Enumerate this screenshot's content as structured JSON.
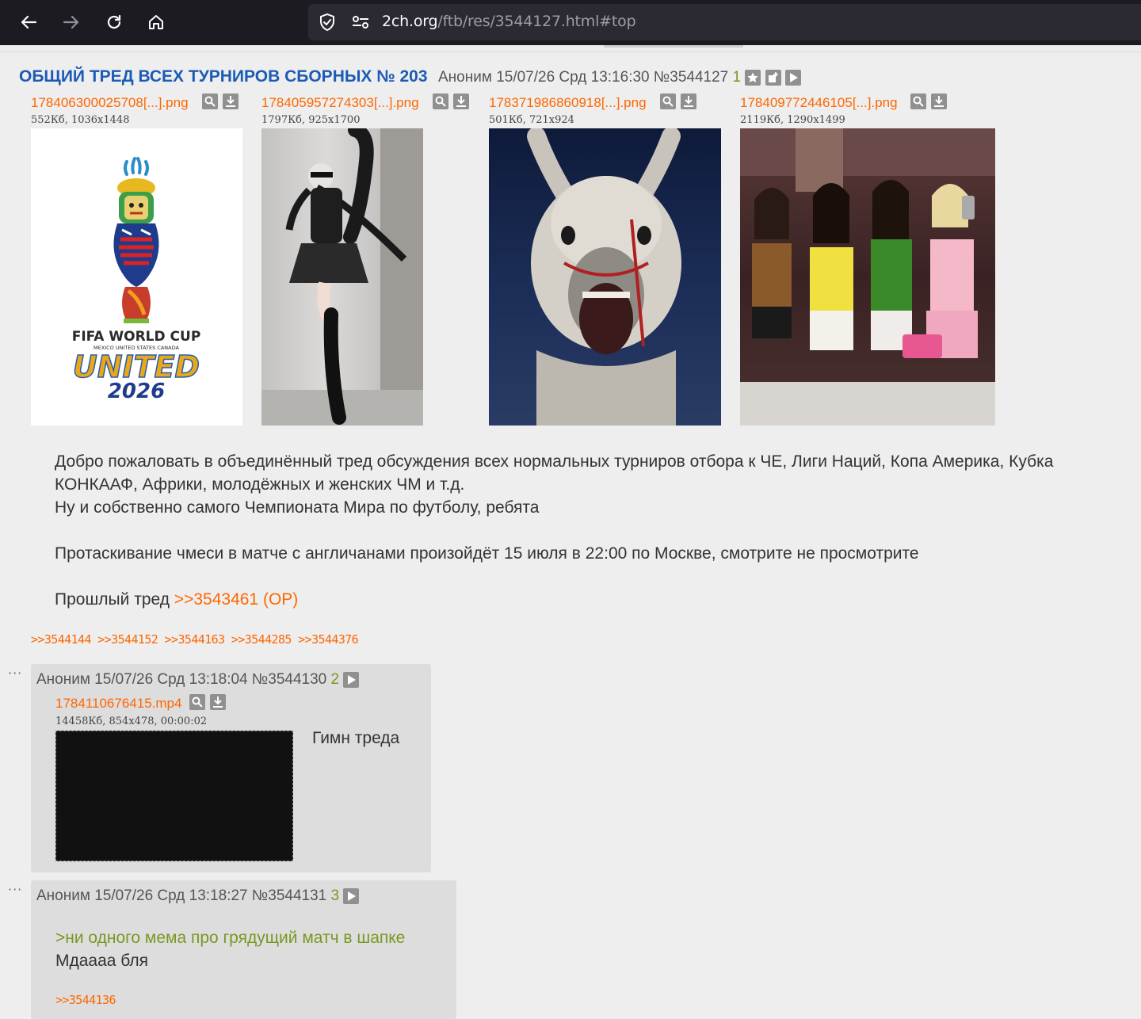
{
  "browser": {
    "url_host": "2ch.org",
    "url_path": "/ftb/res/3544127.html#top"
  },
  "op": {
    "title": "ОБЩИЙ ТРЕД ВСЕХ ТУРНИРОВ СБОРНЫХ № 203",
    "author": "Аноним",
    "date": "15/07/26 Срд 13:16:30",
    "post_number": "№3544127",
    "index": "1",
    "files": [
      {
        "name": "178406300025708[...].png",
        "info": "552Кб, 1036x1448"
      },
      {
        "name": "178405957274303[...].png",
        "info": "1797Кб, 925x1700"
      },
      {
        "name": "178371986860918[...].png",
        "info": "501Кб, 721x924"
      },
      {
        "name": "178409772446105[...].png",
        "info": "2119Кб, 1290x1499"
      }
    ],
    "logo": {
      "line1": "FIFA WORLD CUP",
      "line2": "MEXICO UNITED STATES CANADA",
      "line3": "UNITED",
      "line4": "2026"
    },
    "body": {
      "line1": "Добро пожаловать в объединённый тред обсуждения всех нормальных турниров отбора к ЧЕ, Лиги Наций, Копа Америка, Кубка",
      "line2": "КОНКААФ, Африки, молодёжных и женских ЧМ и т.д.",
      "line3": "Ну и собственно самого Чемпионата Мира по футболу, ребята",
      "line4": "Протаскивание чмеси в матче с англичанами произойдёт 15 июля в 22:00 по Москве, смотрите не просмотрите",
      "line5_text": "Прошлый тред ",
      "line5_link": ">>3543461 (OP)"
    },
    "replies": ">>3544144 >>3544152 >>3544163 >>3544285 >>3544376"
  },
  "post2": {
    "author": "Аноним",
    "date": "15/07/26 Срд 13:18:04",
    "post_number": "№3544130",
    "index": "2",
    "file_name": "1784110676415.mp4",
    "file_info": "14458Кб, 854x478, 00:00:02",
    "text": "Гимн треда"
  },
  "post3": {
    "author": "Аноним",
    "date": "15/07/26 Срд 13:18:27",
    "post_number": "№3544131",
    "index": "3",
    "greentext": ">ни одного мема про грядущий матч в шапке",
    "text": "Мдаааа бля",
    "reply_link": ">>3544136"
  },
  "dots": "···"
}
